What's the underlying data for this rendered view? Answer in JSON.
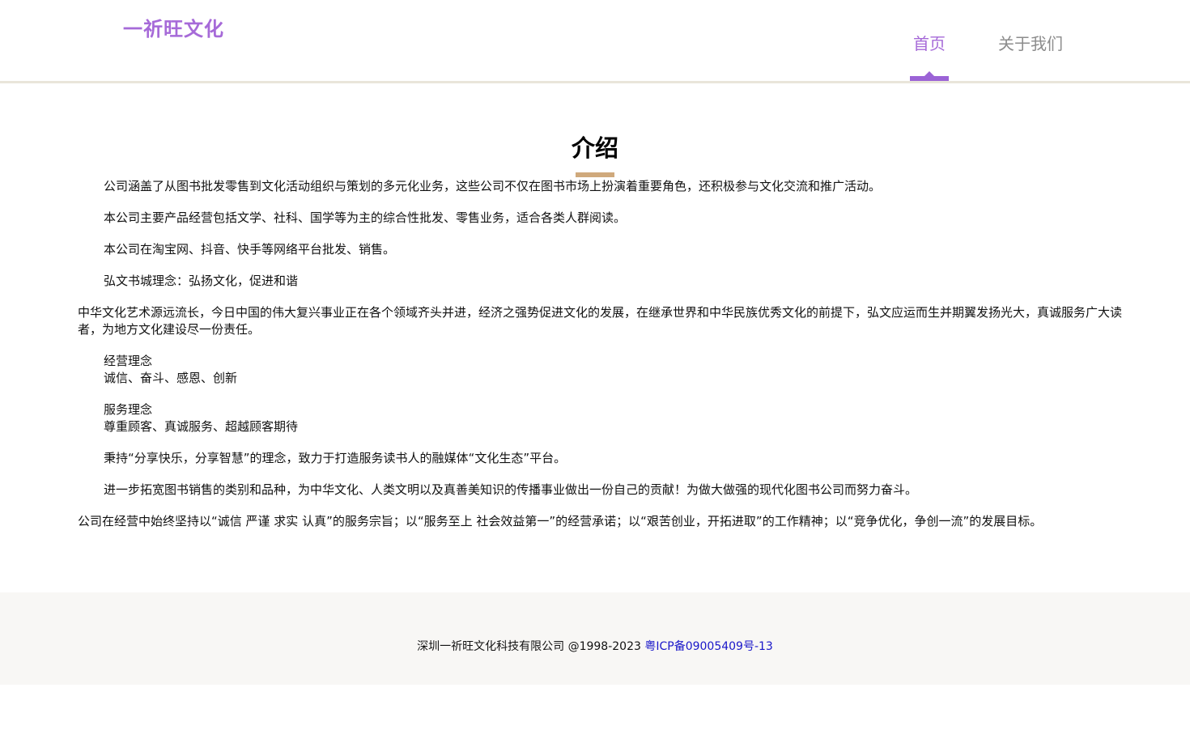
{
  "header": {
    "logo": "一祈旺文化",
    "nav": [
      {
        "label": "首页",
        "active": true
      },
      {
        "label": "关于我们",
        "active": false
      }
    ]
  },
  "colors": {
    "accent": "#a66ad8",
    "title_underline": "#cfa97c",
    "footer_bg": "#f8f7f5",
    "link": "#1a17c9"
  },
  "main": {
    "title": "介绍",
    "paragraphs": [
      {
        "indent": true,
        "lines": [
          "公司涵盖了从图书批发零售到文化活动组织与策划的多元化业务，这些公司不仅在图书市场上扮演着重要角色，还积极参与文化交流和推广活动。"
        ]
      },
      {
        "indent": true,
        "lines": [
          "本公司主要产品经营包括文学、社科、国学等为主的综合性批发、零售业务，适合各类人群阅读。"
        ]
      },
      {
        "indent": true,
        "lines": [
          "本公司在淘宝网、抖音、快手等网络平台批发、销售。"
        ]
      },
      {
        "indent": true,
        "lines": [
          "弘文书城理念：弘扬文化，促进和谐"
        ]
      },
      {
        "indent": false,
        "lines": [
          "中华文化艺术源远流长，今日中国的伟大复兴事业正在各个领域齐头并进，经济之强势促进文化的发展，在继承世界和中华民族优秀文化的前提下，弘文应运而生并期翼发扬光大，真诚服务广大读者，为地方文化建设尽一份责任。"
        ]
      },
      {
        "indent": true,
        "lines": [
          "经营理念",
          "诚信、奋斗、感恩、创新"
        ]
      },
      {
        "indent": true,
        "lines": [
          "服务理念",
          "尊重顾客、真诚服务、超越顾客期待"
        ]
      },
      {
        "indent": true,
        "lines": [
          "秉持“分享快乐，分享智慧”的理念，致力于打造服务读书人的融媒体“文化生态”平台。"
        ]
      },
      {
        "indent": true,
        "lines": [
          "进一步拓宽图书销售的类别和品种，为中华文化、人类文明以及真善美知识的传播事业做出一份自己的贡献！为做大做强的现代化图书公司而努力奋斗。"
        ]
      },
      {
        "indent": false,
        "lines": [
          "公司在经营中始终坚持以“诚信 严谨 求实 认真”的服务宗旨；以“服务至上 社会效益第一”的经营承诺；以“艰苦创业，开拓进取”的工作精神；以“竞争优化，争创一流”的发展目标。"
        ]
      }
    ]
  },
  "footer": {
    "copyright": "深圳一祈旺文化科技有限公司 @1998-2023",
    "icp_link": "粤ICP备09005409号-13"
  }
}
